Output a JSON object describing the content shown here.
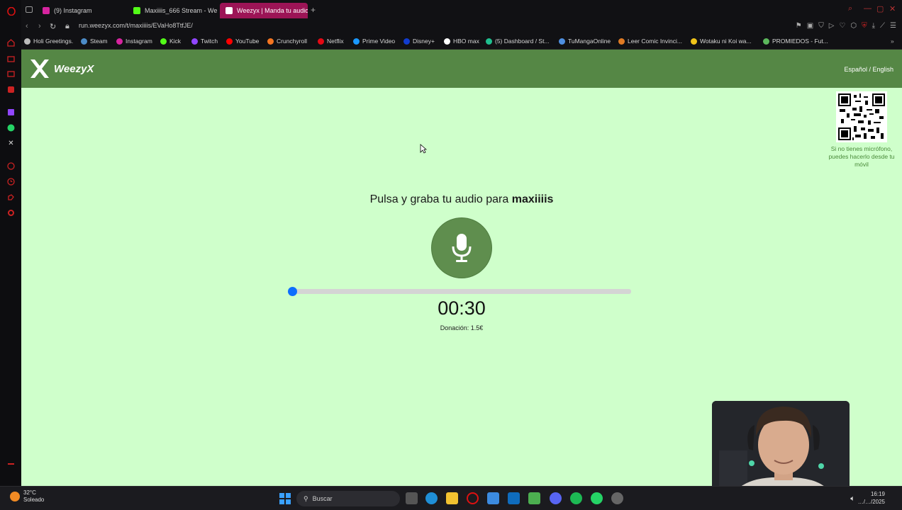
{
  "browser": {
    "tabs": [
      {
        "label": "(9) Instagram",
        "color": "#d6249f"
      },
      {
        "label": "Maxiiiis_666 Stream - We",
        "color": "#53fc18"
      },
      {
        "label": "Weezyx | Manda tu audio",
        "color": "#9c1456"
      }
    ],
    "new_tab_icon": "plus-icon",
    "url": "run.weezyx.com/t/maxiiiis/EVaHo8TtfJE/",
    "bookmarks": [
      {
        "label": "Holi Greetings.",
        "color": "#bbbbbb"
      },
      {
        "label": "Steam",
        "color": "#4c8cc7"
      },
      {
        "label": "Instagram",
        "color": "#d6249f"
      },
      {
        "label": "Kick",
        "color": "#53fc18"
      },
      {
        "label": "Twitch",
        "color": "#9146ff"
      },
      {
        "label": "YouTube",
        "color": "#ff0000"
      },
      {
        "label": "Crunchyroll",
        "color": "#f47521"
      },
      {
        "label": "Netflix",
        "color": "#e50914"
      },
      {
        "label": "Prime Video",
        "color": "#1a98ff"
      },
      {
        "label": "Disney+",
        "color": "#113ccf"
      },
      {
        "label": "HBO max",
        "color": "#ffffff"
      },
      {
        "label": "(5) Dashboard / St...",
        "color": "#1fbf8f"
      },
      {
        "label": "TuMangaOnline",
        "color": "#4e8fe0"
      },
      {
        "label": "Leer Comic Invinci...",
        "color": "#e07b24"
      },
      {
        "label": "Wotaku ni Koi wa...",
        "color": "#f0c419"
      },
      {
        "label": "PROMIEDOS - Fut...",
        "color": "#5cb85c"
      }
    ]
  },
  "site": {
    "logo_text": "WeezyX",
    "language_switch": "Español / English",
    "qr_caption": "Si no tienes micrófono, puedes hacerlo desde tu móvil",
    "prompt_prefix": "Pulsa y graba tu audio para",
    "streamer_name": "maxiiiis",
    "timer": "00:30",
    "donation": "Donación: 1.5€",
    "progress": 0,
    "colors": {
      "header": "#558745",
      "background": "#cfffcb",
      "mic_button": "#5f8e4e",
      "slider_knob": "#0d6efd"
    }
  },
  "taskbar": {
    "temperature": "32°C",
    "condition": "Soleado",
    "search_placeholder": "Buscar",
    "time": "16:19",
    "date": "…/…/2025"
  }
}
